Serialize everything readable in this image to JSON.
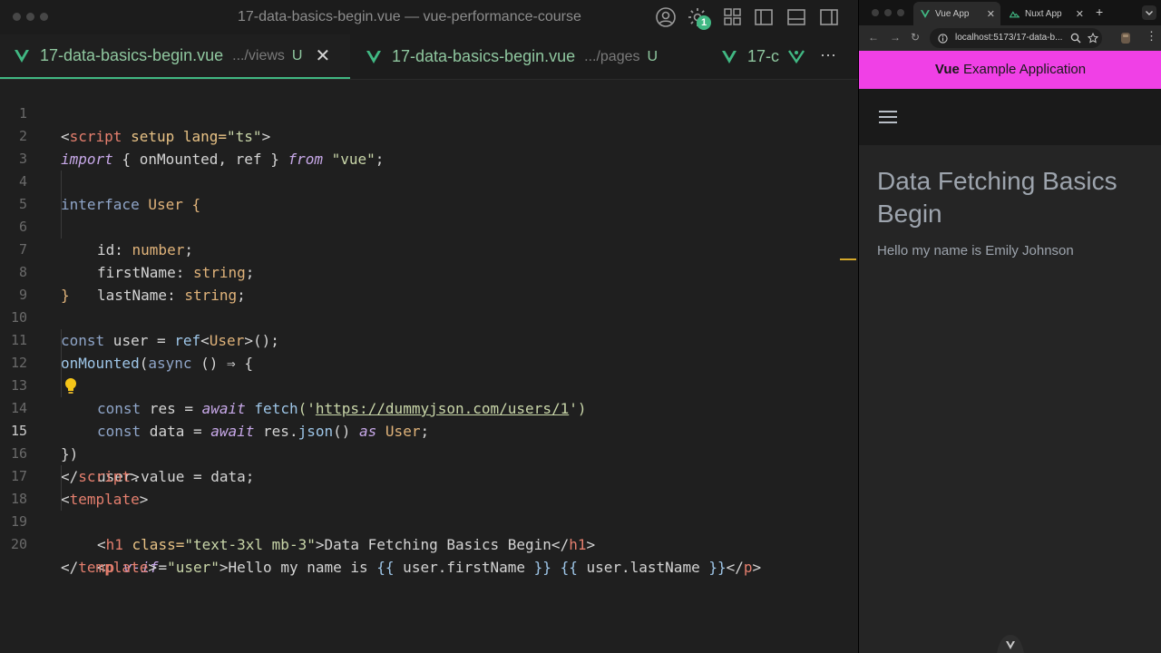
{
  "editor": {
    "window_title": "17-data-basics-begin.vue — vue-performance-course",
    "settings_badge": "1",
    "tabs": [
      {
        "name": "17-data-basics-begin.vue",
        "path": ".../views",
        "status": "U",
        "close": "✕"
      },
      {
        "name": "17-data-basics-begin.vue",
        "path": ".../pages",
        "status": "U"
      },
      {
        "name": "17-c"
      }
    ],
    "more": "···",
    "colors": {
      "accent": "#41b883",
      "git_untracked": "#8fc79f"
    },
    "line_numbers": [
      "1",
      "2",
      "3",
      "4",
      "5",
      "6",
      "7",
      "8",
      "9",
      "10",
      "11",
      "12",
      "13",
      "14",
      "15",
      "16",
      "17",
      "18",
      "19",
      "20"
    ],
    "current_line": "15",
    "code": {
      "l1": [
        "<",
        "script",
        " setup lang=",
        "\"ts\"",
        ">"
      ],
      "l2": [
        "import",
        " { onMounted, ref } ",
        "from",
        " ",
        "\"vue\"",
        ";"
      ],
      "l4": [
        "interface",
        " ",
        "User",
        " {"
      ],
      "l5": [
        "id: ",
        "number",
        ";"
      ],
      "l6": [
        "firstName: ",
        "string",
        ";"
      ],
      "l7": [
        "lastName: ",
        "string",
        ";"
      ],
      "l8": [
        "}"
      ],
      "l10": [
        "const",
        " user = ",
        "ref",
        "<",
        "User",
        ">();"
      ],
      "l11": [
        "onMounted",
        "(",
        "async",
        " () ⇒ {"
      ],
      "l12": [
        "const",
        " res = ",
        "await",
        " ",
        "fetch",
        "('",
        "https://dummyjson.com/users/1",
        "')"
      ],
      "l13": [
        "const",
        " data = ",
        "await",
        " res.",
        "json",
        "() ",
        "as",
        " ",
        "User",
        ";"
      ],
      "l14": [
        "user.value = data;"
      ],
      "l15": [
        "})"
      ],
      "l16": [
        "</",
        "script",
        ">"
      ],
      "l17": [
        "<",
        "template",
        ">"
      ],
      "l18": [
        "<",
        "h1",
        " class=",
        "\"text-3xl mb-3\"",
        ">Data Fetching Basics Begin</",
        "h1",
        ">"
      ],
      "l19": [
        "<",
        "p",
        " ",
        "v-if",
        "=",
        "\"user\"",
        ">Hello my name is ",
        "{{",
        " user.firstName ",
        "}}",
        " ",
        "{{",
        " user.lastName ",
        "}}",
        "</",
        "p",
        ">"
      ],
      "l20": [
        "</",
        "template",
        ">"
      ]
    }
  },
  "browser": {
    "tabs": [
      {
        "title": "Vue App",
        "close": "✕"
      },
      {
        "title": "Nuxt App",
        "close": "✕"
      }
    ],
    "new_tab": "+",
    "url": "localhost:5173/17-data-b...",
    "app": {
      "header_brand": "Vue",
      "header_rest": " Example Application",
      "heading": "Data Fetching Basics Begin",
      "greeting": "Hello my name is Emily Johnson"
    },
    "colors": {
      "header_bg": "#f040e6"
    }
  }
}
